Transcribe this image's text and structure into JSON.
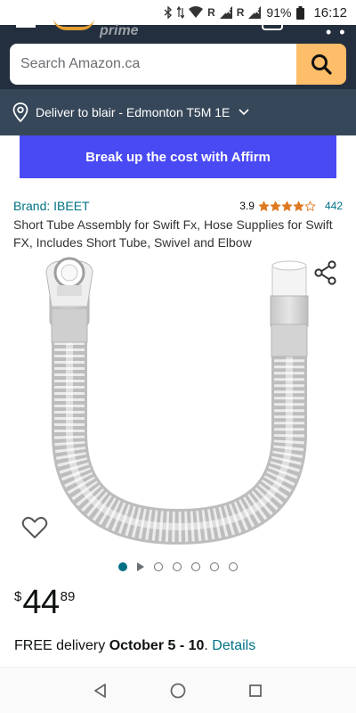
{
  "status_bar": {
    "signal_r1": "R",
    "signal_r2": "R",
    "battery": "91%",
    "time": "16:12"
  },
  "header": {
    "prime_label": "prime",
    "search_placeholder": "Search Amazon.ca"
  },
  "deliver": {
    "text": "Deliver to blair - Edmonton T5M 1E"
  },
  "affirm": {
    "label": "Break up the cost with Affirm"
  },
  "product": {
    "brand": "Brand: IBEET",
    "rating": "3.9",
    "rating_stars": 3.9,
    "rating_count": "442",
    "title": "Short Tube Assembly for Swift Fx, Hose Supplies for Swift FX, Includes Short Tube, Swivel and Elbow"
  },
  "carousel": {
    "total_slides": 7,
    "active_index": 0,
    "video_index": 1
  },
  "price": {
    "symbol": "$",
    "whole": "44",
    "fraction": "89"
  },
  "delivery": {
    "prefix": "FREE delivery ",
    "dates": "October 5 - 10",
    "separator": ". ",
    "details_link": "Details"
  },
  "colors": {
    "header_bg": "#232f3e",
    "deliver_bg": "#37475a",
    "search_button": "#febd69",
    "affirm_bg": "#4a4af4",
    "link": "#007185",
    "star": "#de7921"
  },
  "icons": {
    "location": "location-pin-icon",
    "search": "search-icon",
    "share": "share-icon",
    "wishlist": "heart-icon",
    "nav_back": "back-triangle-icon",
    "nav_home": "home-circle-icon",
    "nav_recents": "recents-square-icon"
  }
}
